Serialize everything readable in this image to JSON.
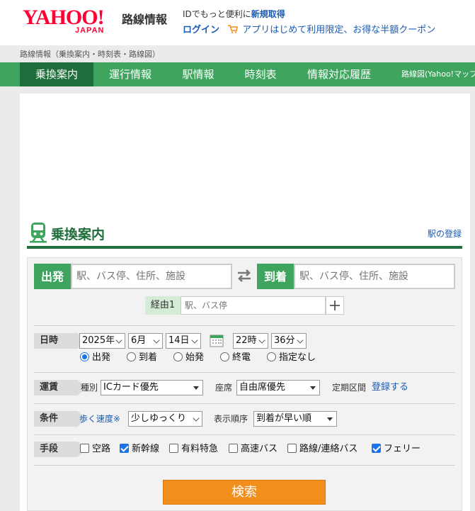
{
  "header": {
    "logo_text": "YAHOO!",
    "logo_sub": "JAPAN",
    "service_name": "路線情報",
    "id_promo_text": "IDでもっと便利に",
    "id_promo_link": "新規取得",
    "login_label": "ログイン",
    "coupon_text": "アプリはじめて利用限定、お得な半額クーポン"
  },
  "breadcrumb": "路線情報（乗換案内・時刻表・路線図）",
  "nav": {
    "tabs": [
      {
        "label": "乗換案内"
      },
      {
        "label": "運行情報"
      },
      {
        "label": "駅情報"
      },
      {
        "label": "時刻表"
      },
      {
        "label": "情報対応履歴"
      },
      {
        "label": "路線図(Yahoo!マップ"
      }
    ]
  },
  "section": {
    "title": "乗換案内",
    "register_link": "駅の登録"
  },
  "search": {
    "departure_label": "出発",
    "departure_placeholder": "駅、バス停、住所、施設",
    "arrival_label": "到着",
    "arrival_placeholder": "駅、バス停、住所、施設",
    "via_label": "経由1",
    "via_placeholder": "駅、バス停"
  },
  "datetime": {
    "label": "日時",
    "year": "2025年",
    "month": "6月",
    "day": "14日",
    "hour": "22時",
    "minute": "36分",
    "options": [
      "出発",
      "到着",
      "始発",
      "終電",
      "指定なし"
    ],
    "selected_index": 0
  },
  "fare": {
    "label": "運賃",
    "type_label": "種別",
    "type_value": "ICカード優先",
    "seat_label": "座席",
    "seat_value": "自由席優先",
    "commuter_label": "定期区間",
    "commuter_link": "登録する"
  },
  "conditions": {
    "label": "条件",
    "walk_speed_link": "歩く速度※",
    "walk_speed_value": "少しゆっくり",
    "order_label": "表示順序",
    "order_value": "到着が早い順"
  },
  "means": {
    "label": "手段",
    "options": [
      {
        "label": "空路",
        "checked": false
      },
      {
        "label": "新幹線",
        "checked": true
      },
      {
        "label": "有料特急",
        "checked": false
      },
      {
        "label": "高速バス",
        "checked": false
      },
      {
        "label": "路線/連絡バス",
        "checked": false
      },
      {
        "label": "フェリー",
        "checked": true
      }
    ]
  },
  "search_button": "検索",
  "colors": {
    "brand_red": "#ff0033",
    "nav_green": "#3ea45e",
    "nav_active": "#1f6e3c",
    "link_blue": "#1a5bb5",
    "search_orange": "#f18e1c"
  }
}
